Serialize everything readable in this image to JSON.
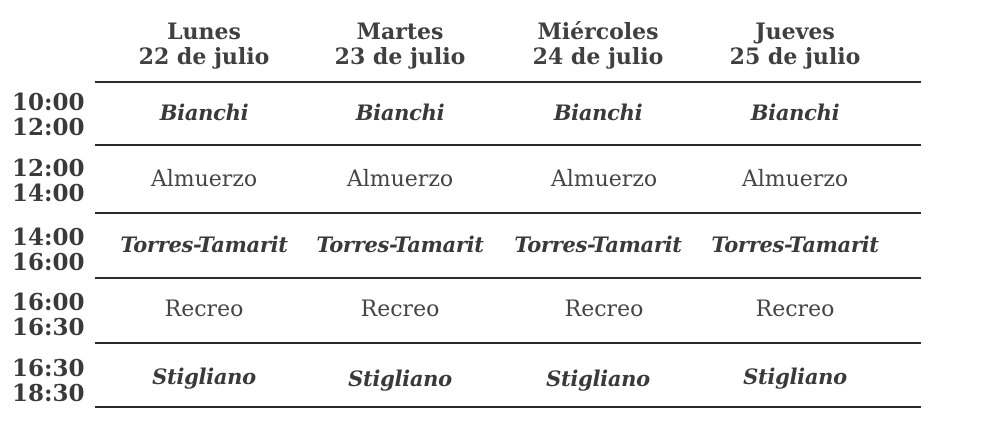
{
  "days": [
    {
      "name": "Lunes",
      "date": "22 de julio"
    },
    {
      "name": "Martes",
      "date": "23 de julio"
    },
    {
      "name": "Miércoles",
      "date": "24 de julio"
    },
    {
      "name": "Jueves",
      "date": "25 de julio"
    }
  ],
  "slots": [
    {
      "start": "10:00",
      "end": "12:00",
      "type": "session",
      "cells": [
        "Bianchi",
        "Bianchi",
        "Bianchi",
        "Bianchi"
      ]
    },
    {
      "start": "12:00",
      "end": "14:00",
      "type": "break",
      "cells": [
        "Almuerzo",
        "Almuerzo",
        "Almuerzo",
        "Almuerzo"
      ]
    },
    {
      "start": "14:00",
      "end": "16:00",
      "type": "session",
      "cells": [
        "Torres-Tamarit",
        "Torres-Tamarit",
        "Torres-Tamarit",
        "Torres-Tamarit"
      ]
    },
    {
      "start": "16:00",
      "end": "16:30",
      "type": "break",
      "cells": [
        "Recreo",
        "Recreo",
        "Recreo",
        "Recreo"
      ]
    },
    {
      "start": "16:30",
      "end": "18:30",
      "type": "session",
      "cells": [
        "Stigliano",
        "Stigliano",
        "Stigliano",
        "Stigliano"
      ]
    }
  ]
}
